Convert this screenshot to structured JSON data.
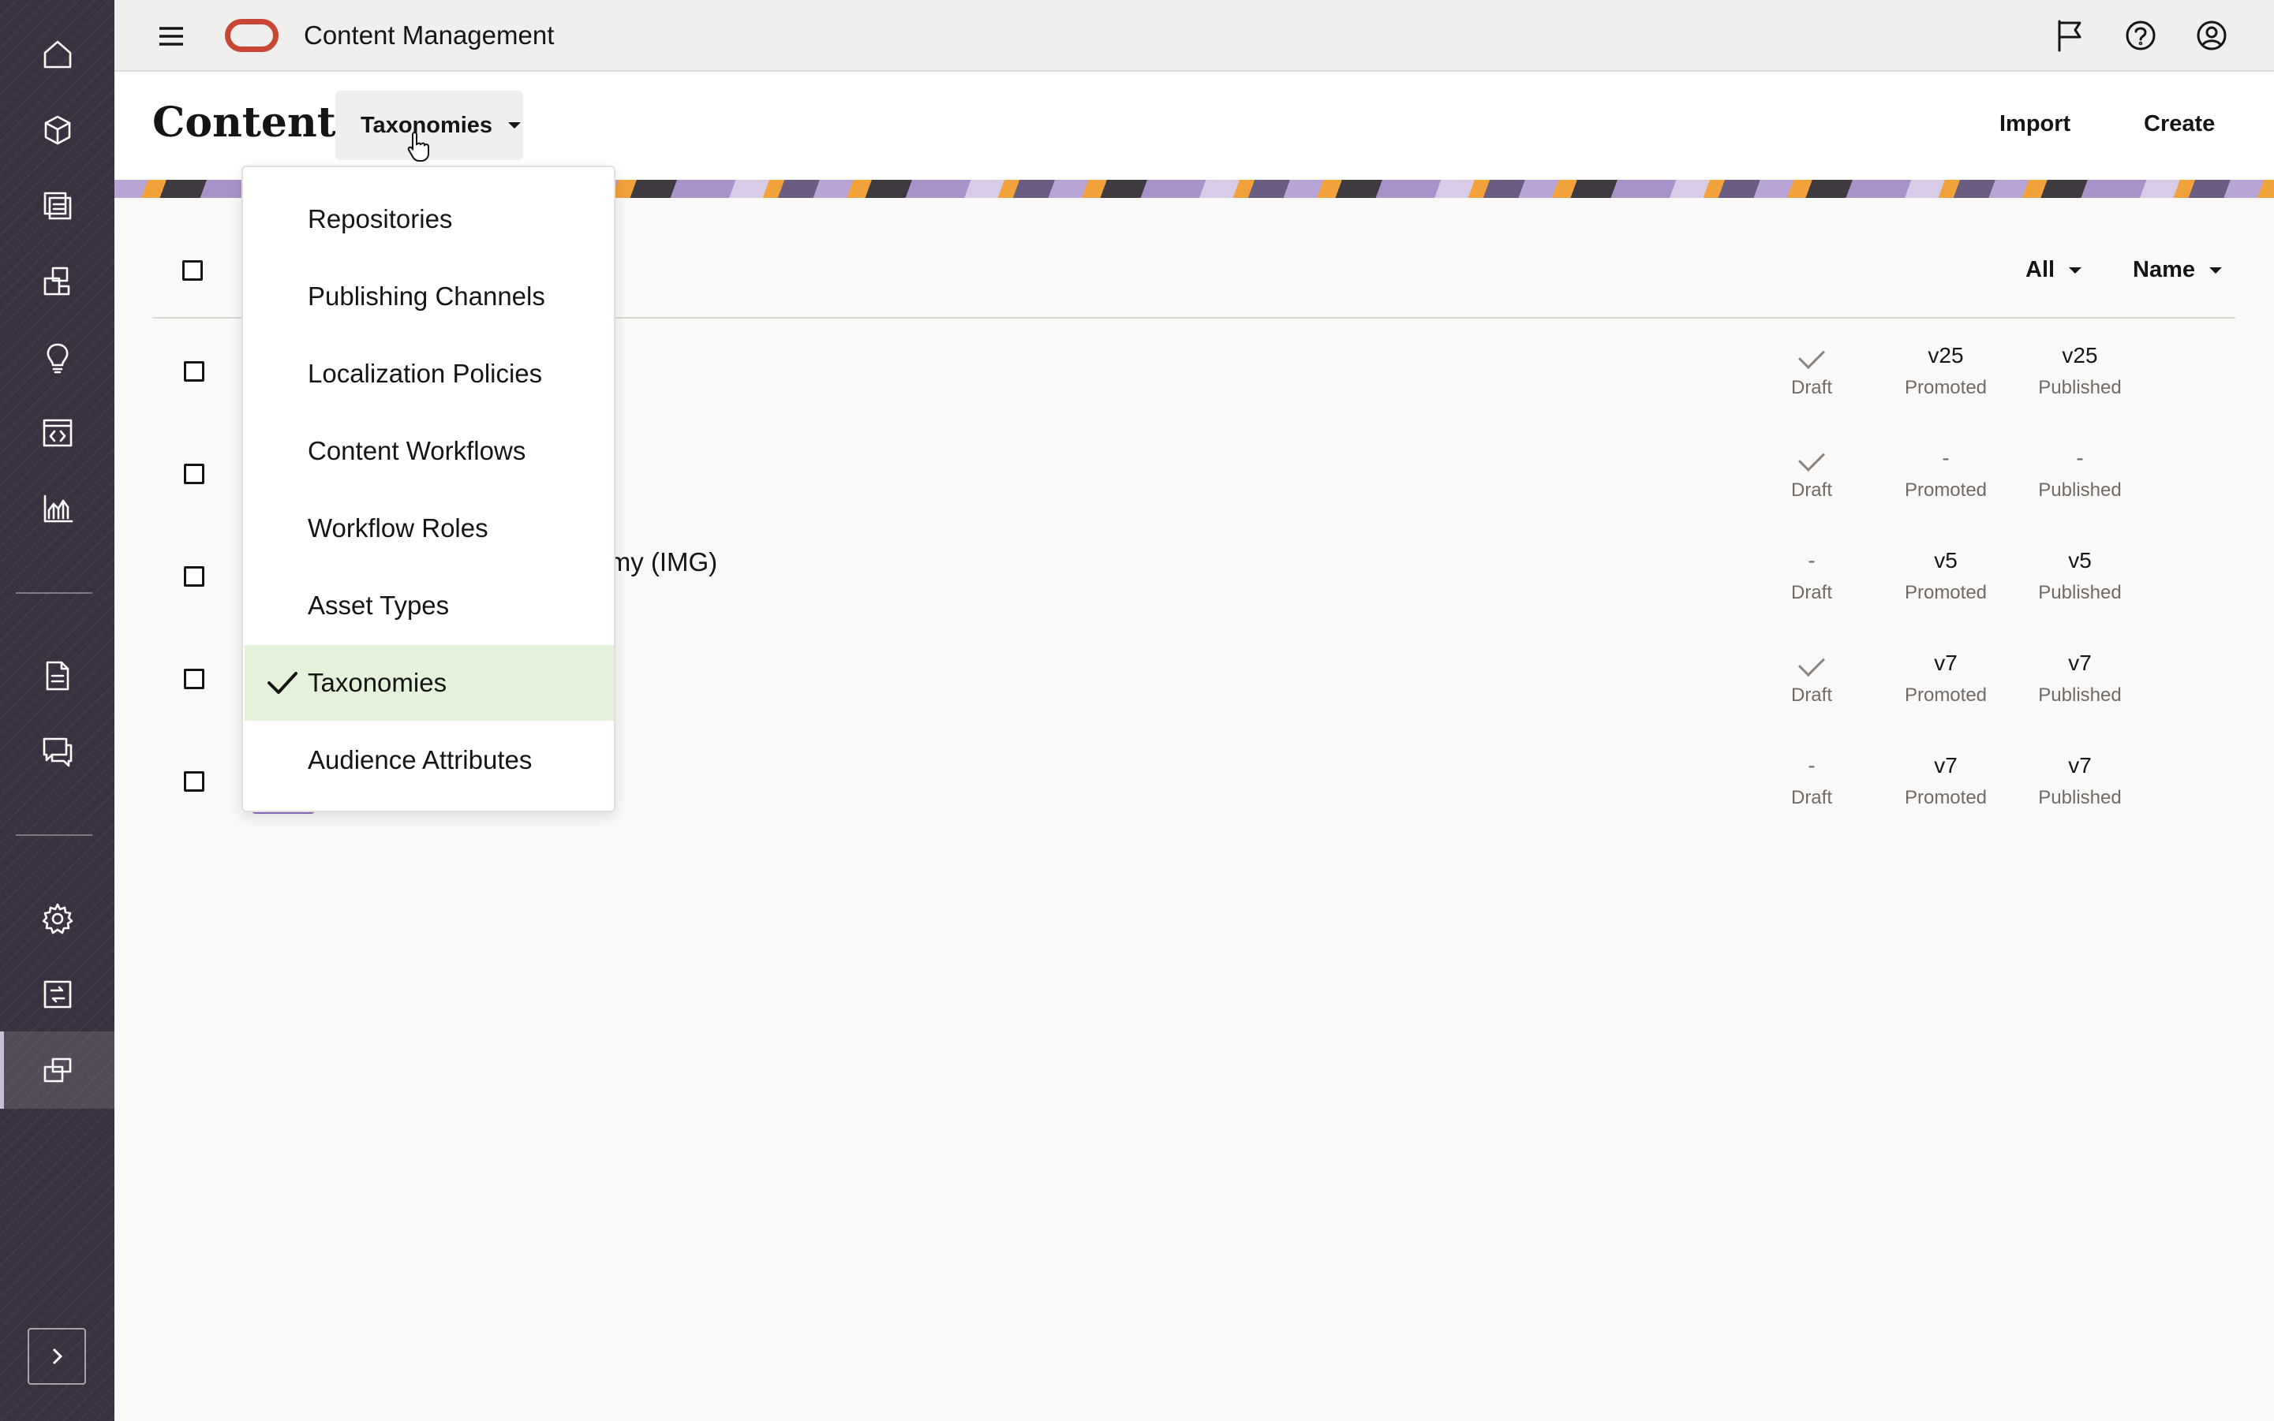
{
  "app": {
    "title": "Content Management",
    "brand_color": "#c74634"
  },
  "rail": {
    "items": [
      {
        "icon": "home-icon"
      },
      {
        "icon": "cube-icon"
      },
      {
        "icon": "assets-icon"
      },
      {
        "icon": "sites-icon"
      },
      {
        "icon": "lightbulb-icon"
      },
      {
        "icon": "developer-icon"
      },
      {
        "icon": "analytics-icon"
      },
      {
        "icon": "documents-icon"
      },
      {
        "icon": "conversations-icon"
      },
      {
        "icon": "settings-icon"
      },
      {
        "icon": "integrations-icon"
      },
      {
        "icon": "content-icon"
      }
    ],
    "active_index": 11
  },
  "page": {
    "title": "Content",
    "view_selector": "Taxonomies",
    "import_label": "Import",
    "create_label": "Create"
  },
  "table": {
    "filter": "All",
    "sort": "Name",
    "rows": [
      {
        "name": "",
        "draft": "check",
        "promoted": "v25",
        "published": "v25"
      },
      {
        "name": "",
        "draft": "check",
        "promoted": "-",
        "published": "-"
      },
      {
        "name": "nomy (IMG)",
        "draft": "-",
        "promoted": "v5",
        "published": "v5"
      },
      {
        "name": "",
        "draft": "check",
        "promoted": "v7",
        "published": "v7"
      },
      {
        "name": "",
        "draft": "-",
        "promoted": "v7",
        "published": "v7"
      }
    ],
    "labels": {
      "draft": "Draft",
      "promoted": "Promoted",
      "published": "Published"
    }
  },
  "menu": {
    "items": [
      "Repositories",
      "Publishing Channels",
      "Localization Policies",
      "Content Workflows",
      "Workflow Roles",
      "Asset Types",
      "Taxonomies",
      "Audience Attributes"
    ],
    "selected": "Taxonomies",
    "selected_color": "#e3f2d9"
  }
}
